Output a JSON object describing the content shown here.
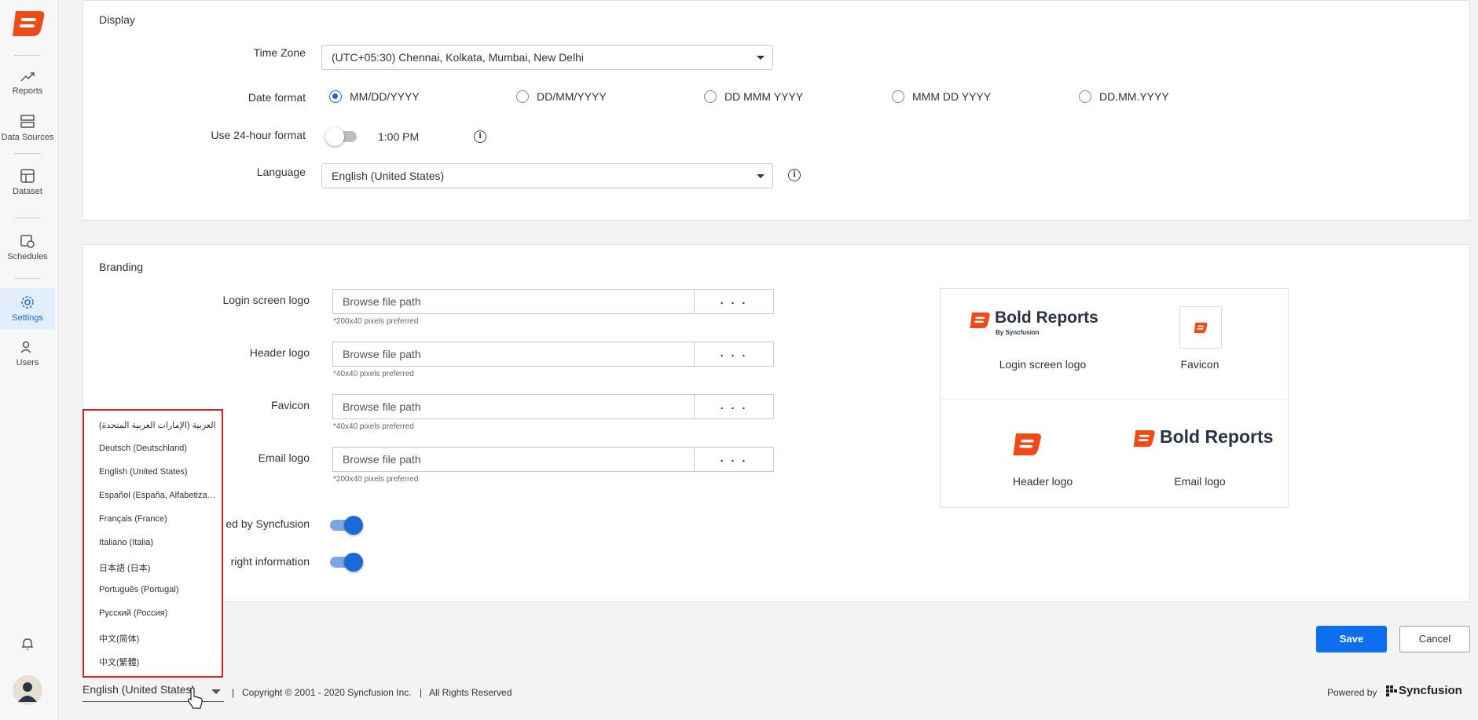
{
  "sidebar": {
    "items": [
      {
        "label": "Reports",
        "icon": "trend-up-icon"
      },
      {
        "label": "Data Sources",
        "icon": "server-icon"
      },
      {
        "label": "Dataset",
        "icon": "dataset-icon"
      },
      {
        "label": "Schedules",
        "icon": "calendar-clock-icon"
      },
      {
        "label": "Settings",
        "icon": "gear-icon",
        "active": true
      },
      {
        "label": "Users",
        "icon": "users-icon"
      }
    ]
  },
  "display": {
    "title": "Display",
    "timezone_label": "Time Zone",
    "timezone_value": "(UTC+05:30) Chennai, Kolkata, Mumbai, New Delhi",
    "date_format_label": "Date format",
    "date_formats": [
      "MM/DD/YYYY",
      "DD/MM/YYYY",
      "DD MMM YYYY",
      "MMM DD YYYY",
      "DD.MM.YYYY"
    ],
    "selected_date_format": "MM/DD/YYYY",
    "use24_label": "Use 24-hour format",
    "use24_enabled": false,
    "time_preview": "1:00 PM",
    "language_label": "Language",
    "language_value": "English (United States)"
  },
  "branding": {
    "title": "Branding",
    "login_logo_label": "Login screen logo",
    "header_logo_label": "Header logo",
    "favicon_label": "Favicon",
    "email_logo_label": "Email logo",
    "browse_placeholder": "Browse file path",
    "browse_button": ". . .",
    "login_hint": "*200x40 pixels preferred",
    "header_hint": "*40x40 pixels preferred",
    "favicon_hint": "*40x40 pixels preferred",
    "email_hint": "*200x40 pixels preferred",
    "powered_label_partial": "ed by Syncfusion",
    "copyright_label_partial": "right information",
    "powered_enabled": true,
    "copyright_enabled": true,
    "preview": {
      "login_label": "Login screen logo",
      "favicon_label": "Favicon",
      "header_label": "Header logo",
      "email_label": "Email logo",
      "brand_name": "Bold Reports",
      "brand_sub": "By Syncfusion"
    }
  },
  "language_dropdown": {
    "options": [
      "العربية (الإمارات العربية المتحدة)",
      "Deutsch (Deutschland)",
      "English (United States)",
      "Español (España, Alfabetización internacional)",
      "Français (France)",
      "Italiano (Italia)",
      "日本語 (日本)",
      "Português (Portugal)",
      "Русский (Россия)",
      "中文(简体)",
      "中文(繁體)"
    ]
  },
  "actions": {
    "save": "Save",
    "cancel": "Cancel"
  },
  "footer": {
    "language": "English (United States)",
    "copyright": "Copyright © 2001 - 2020 Syncfusion Inc.",
    "rights": "All Rights Reserved",
    "powered_by": "Powered by",
    "brand": "Syncfusion"
  },
  "colors": {
    "accent": "#1a6bd6",
    "brand_orange": "#f04a16",
    "brand_navy": "#2a3446",
    "save_button": "#0d6ef0",
    "dropdown_highlight": "#e02020"
  }
}
